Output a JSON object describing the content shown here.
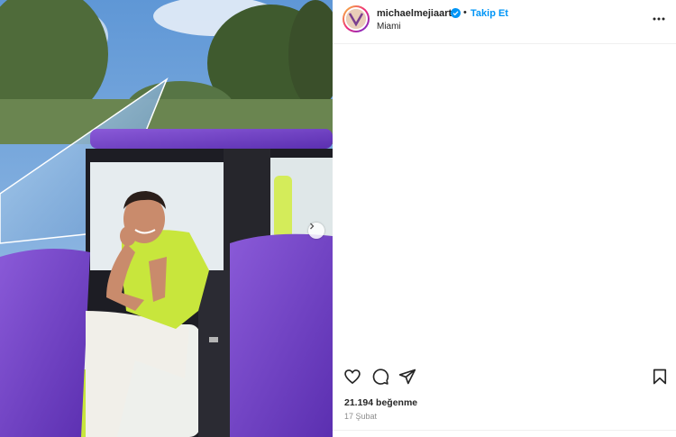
{
  "post": {
    "username": "michaelmejiaart",
    "follow_label": "Takip Et",
    "separator": "•",
    "location": "Miami",
    "likes_text": "21.194 beğenme",
    "date_text": "17 Şubat"
  },
  "icons": {
    "verified": "verified-badge-icon",
    "more": "more-options-icon",
    "like": "heart-icon",
    "comment": "comment-icon",
    "share": "share-icon",
    "save": "bookmark-icon",
    "next": "chevron-right-icon"
  },
  "colors": {
    "accent": "#0095f6",
    "text": "#262626",
    "muted": "#8e8e8e",
    "car": "#6b3fc4",
    "shirt": "#c8e63c"
  }
}
